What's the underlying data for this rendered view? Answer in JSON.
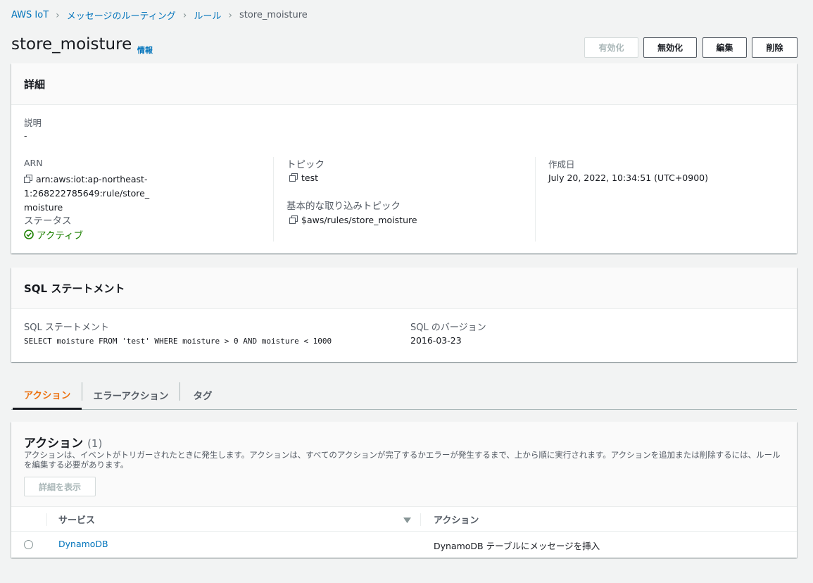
{
  "breadcrumb": {
    "items": [
      "AWS IoT",
      "メッセージのルーティング",
      "ルール"
    ],
    "current": "store_moisture"
  },
  "header": {
    "title": "store_moisture",
    "info_link": "情報",
    "buttons": {
      "enable": "有効化",
      "disable": "無効化",
      "edit": "編集",
      "delete": "削除"
    }
  },
  "details": {
    "title": "詳細",
    "description_label": "説明",
    "description_value": "-",
    "arn_label": "ARN",
    "arn_line1": "arn:aws:iot:ap-northeast-1:268222785649:rule/store_",
    "arn_line2": "moisture",
    "status_label": "ステータス",
    "status_value": "アクティブ",
    "topic_label": "トピック",
    "topic_value": "test",
    "basic_ingest_label": "基本的な取り込みトピック",
    "basic_ingest_value": "$aws/rules/store_moisture",
    "created_label": "作成日",
    "created_value": "July 20, 2022, 10:34:51 (UTC+0900)"
  },
  "sql": {
    "title": "SQL ステートメント",
    "statement_label": "SQL ステートメント",
    "statement_value": "SELECT moisture FROM 'test' WHERE moisture > 0 AND moisture < 1000",
    "version_label": "SQL のバージョン",
    "version_value": "2016-03-23"
  },
  "tabs": [
    {
      "label": "アクション",
      "active": true
    },
    {
      "label": "エラーアクション",
      "active": false
    },
    {
      "label": "タグ",
      "active": false
    }
  ],
  "actions": {
    "title": "アクション",
    "count": "(1)",
    "description": "アクションは、イベントがトリガーされたときに発生します。アクションは、すべてのアクションが完了するかエラーが発生するまで、上から順に実行されます。アクションを追加または削除するには、ルールを編集する必要があります。",
    "view_details_button": "詳細を表示",
    "columns": [
      "サービス",
      "アクション"
    ],
    "rows": [
      {
        "service": "DynamoDB",
        "action": "DynamoDB テーブルにメッセージを挿入"
      }
    ]
  },
  "colors": {
    "link": "#0073bb",
    "active_tab": "#ec7211",
    "success": "#1d8102",
    "background": "#f2f3f3"
  },
  "icons": [
    "chevron-right-icon",
    "copy-icon",
    "status-success-icon",
    "sort-caret-down-icon",
    "radio-button"
  ]
}
